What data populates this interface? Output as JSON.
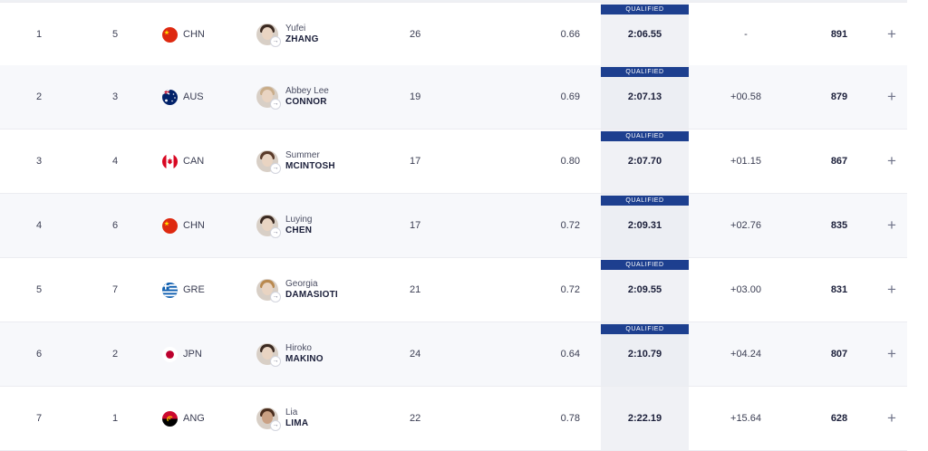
{
  "qualified_label": "QUALIFIED",
  "rows": [
    {
      "rank": "1",
      "lane": "5",
      "country": "CHN",
      "flag": "china",
      "first": "Yufei",
      "last": "ZHANG",
      "age": "26",
      "reaction": "0.66",
      "time": "2:06.55",
      "behind": "-",
      "points": "891",
      "qualified": true
    },
    {
      "rank": "2",
      "lane": "3",
      "country": "AUS",
      "flag": "australia",
      "first": "Abbey Lee",
      "last": "CONNOR",
      "age": "19",
      "reaction": "0.69",
      "time": "2:07.13",
      "behind": "+00.58",
      "points": "879",
      "qualified": true
    },
    {
      "rank": "3",
      "lane": "4",
      "country": "CAN",
      "flag": "canada",
      "first": "Summer",
      "last": "MCINTOSH",
      "age": "17",
      "reaction": "0.80",
      "time": "2:07.70",
      "behind": "+01.15",
      "points": "867",
      "qualified": true
    },
    {
      "rank": "4",
      "lane": "6",
      "country": "CHN",
      "flag": "china",
      "first": "Luying",
      "last": "CHEN",
      "age": "17",
      "reaction": "0.72",
      "time": "2:09.31",
      "behind": "+02.76",
      "points": "835",
      "qualified": true
    },
    {
      "rank": "5",
      "lane": "7",
      "country": "GRE",
      "flag": "greece",
      "first": "Georgia",
      "last": "DAMASIOTI",
      "age": "21",
      "reaction": "0.72",
      "time": "2:09.55",
      "behind": "+03.00",
      "points": "831",
      "qualified": true
    },
    {
      "rank": "6",
      "lane": "2",
      "country": "JPN",
      "flag": "japan",
      "first": "Hiroko",
      "last": "MAKINO",
      "age": "24",
      "reaction": "0.64",
      "time": "2:10.79",
      "behind": "+04.24",
      "points": "807",
      "qualified": true
    },
    {
      "rank": "7",
      "lane": "1",
      "country": "ANG",
      "flag": "angola",
      "first": "Lia",
      "last": "LIMA",
      "age": "22",
      "reaction": "0.78",
      "time": "2:22.19",
      "behind": "+15.64",
      "points": "628",
      "qualified": false
    }
  ],
  "expand_symbol": "+"
}
